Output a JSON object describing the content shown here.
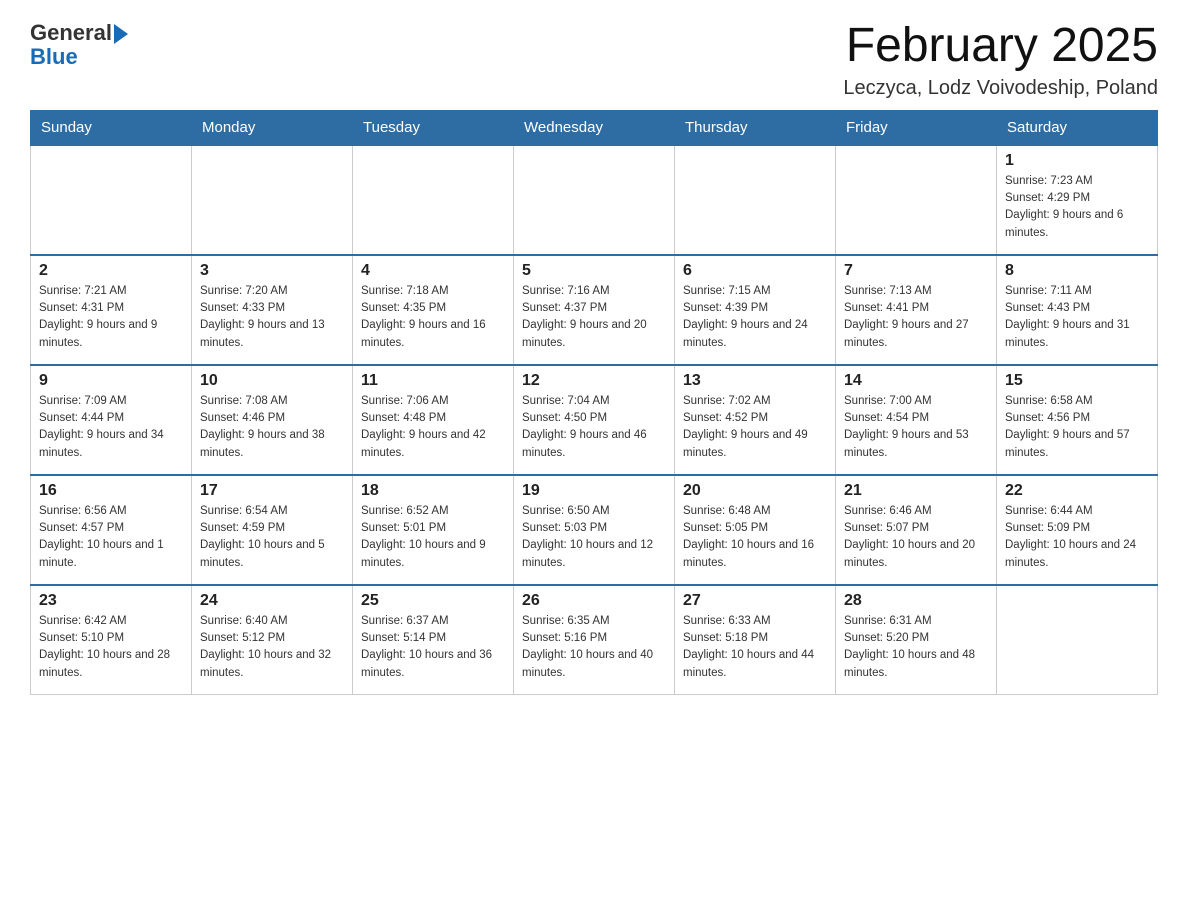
{
  "header": {
    "logo_general": "General",
    "logo_blue": "Blue",
    "title": "February 2025",
    "subtitle": "Leczyca, Lodz Voivodeship, Poland"
  },
  "days_of_week": [
    "Sunday",
    "Monday",
    "Tuesday",
    "Wednesday",
    "Thursday",
    "Friday",
    "Saturday"
  ],
  "weeks": [
    [
      {
        "day": "",
        "info": ""
      },
      {
        "day": "",
        "info": ""
      },
      {
        "day": "",
        "info": ""
      },
      {
        "day": "",
        "info": ""
      },
      {
        "day": "",
        "info": ""
      },
      {
        "day": "",
        "info": ""
      },
      {
        "day": "1",
        "info": "Sunrise: 7:23 AM\nSunset: 4:29 PM\nDaylight: 9 hours and 6 minutes."
      }
    ],
    [
      {
        "day": "2",
        "info": "Sunrise: 7:21 AM\nSunset: 4:31 PM\nDaylight: 9 hours and 9 minutes."
      },
      {
        "day": "3",
        "info": "Sunrise: 7:20 AM\nSunset: 4:33 PM\nDaylight: 9 hours and 13 minutes."
      },
      {
        "day": "4",
        "info": "Sunrise: 7:18 AM\nSunset: 4:35 PM\nDaylight: 9 hours and 16 minutes."
      },
      {
        "day": "5",
        "info": "Sunrise: 7:16 AM\nSunset: 4:37 PM\nDaylight: 9 hours and 20 minutes."
      },
      {
        "day": "6",
        "info": "Sunrise: 7:15 AM\nSunset: 4:39 PM\nDaylight: 9 hours and 24 minutes."
      },
      {
        "day": "7",
        "info": "Sunrise: 7:13 AM\nSunset: 4:41 PM\nDaylight: 9 hours and 27 minutes."
      },
      {
        "day": "8",
        "info": "Sunrise: 7:11 AM\nSunset: 4:43 PM\nDaylight: 9 hours and 31 minutes."
      }
    ],
    [
      {
        "day": "9",
        "info": "Sunrise: 7:09 AM\nSunset: 4:44 PM\nDaylight: 9 hours and 34 minutes."
      },
      {
        "day": "10",
        "info": "Sunrise: 7:08 AM\nSunset: 4:46 PM\nDaylight: 9 hours and 38 minutes."
      },
      {
        "day": "11",
        "info": "Sunrise: 7:06 AM\nSunset: 4:48 PM\nDaylight: 9 hours and 42 minutes."
      },
      {
        "day": "12",
        "info": "Sunrise: 7:04 AM\nSunset: 4:50 PM\nDaylight: 9 hours and 46 minutes."
      },
      {
        "day": "13",
        "info": "Sunrise: 7:02 AM\nSunset: 4:52 PM\nDaylight: 9 hours and 49 minutes."
      },
      {
        "day": "14",
        "info": "Sunrise: 7:00 AM\nSunset: 4:54 PM\nDaylight: 9 hours and 53 minutes."
      },
      {
        "day": "15",
        "info": "Sunrise: 6:58 AM\nSunset: 4:56 PM\nDaylight: 9 hours and 57 minutes."
      }
    ],
    [
      {
        "day": "16",
        "info": "Sunrise: 6:56 AM\nSunset: 4:57 PM\nDaylight: 10 hours and 1 minute."
      },
      {
        "day": "17",
        "info": "Sunrise: 6:54 AM\nSunset: 4:59 PM\nDaylight: 10 hours and 5 minutes."
      },
      {
        "day": "18",
        "info": "Sunrise: 6:52 AM\nSunset: 5:01 PM\nDaylight: 10 hours and 9 minutes."
      },
      {
        "day": "19",
        "info": "Sunrise: 6:50 AM\nSunset: 5:03 PM\nDaylight: 10 hours and 12 minutes."
      },
      {
        "day": "20",
        "info": "Sunrise: 6:48 AM\nSunset: 5:05 PM\nDaylight: 10 hours and 16 minutes."
      },
      {
        "day": "21",
        "info": "Sunrise: 6:46 AM\nSunset: 5:07 PM\nDaylight: 10 hours and 20 minutes."
      },
      {
        "day": "22",
        "info": "Sunrise: 6:44 AM\nSunset: 5:09 PM\nDaylight: 10 hours and 24 minutes."
      }
    ],
    [
      {
        "day": "23",
        "info": "Sunrise: 6:42 AM\nSunset: 5:10 PM\nDaylight: 10 hours and 28 minutes."
      },
      {
        "day": "24",
        "info": "Sunrise: 6:40 AM\nSunset: 5:12 PM\nDaylight: 10 hours and 32 minutes."
      },
      {
        "day": "25",
        "info": "Sunrise: 6:37 AM\nSunset: 5:14 PM\nDaylight: 10 hours and 36 minutes."
      },
      {
        "day": "26",
        "info": "Sunrise: 6:35 AM\nSunset: 5:16 PM\nDaylight: 10 hours and 40 minutes."
      },
      {
        "day": "27",
        "info": "Sunrise: 6:33 AM\nSunset: 5:18 PM\nDaylight: 10 hours and 44 minutes."
      },
      {
        "day": "28",
        "info": "Sunrise: 6:31 AM\nSunset: 5:20 PM\nDaylight: 10 hours and 48 minutes."
      },
      {
        "day": "",
        "info": ""
      }
    ]
  ]
}
